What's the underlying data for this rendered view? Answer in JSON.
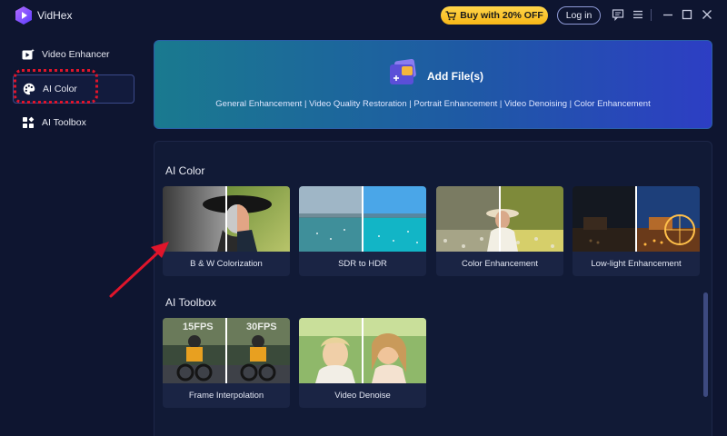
{
  "app": {
    "name": "VidHex"
  },
  "header": {
    "buy_label": "Buy with 20% OFF",
    "login_label": "Log in",
    "accent": "#f7b718"
  },
  "sidebar": {
    "items": [
      {
        "label": "Video Enhancer",
        "icon": "video-enhancer-icon"
      },
      {
        "label": "AI Color",
        "icon": "palette-icon"
      },
      {
        "label": "AI Toolbox",
        "icon": "toolbox-icon"
      }
    ],
    "active_index": 1
  },
  "banner": {
    "title": "Add File(s)",
    "subtitle": "General Enhancement | Video Quality Restoration | Portrait Enhancement | Video Denoising | Color Enhancement"
  },
  "sections": {
    "ai_color": {
      "title": "AI Color",
      "cards": [
        {
          "label": "B & W Colorization"
        },
        {
          "label": "SDR to HDR"
        },
        {
          "label": "Color Enhancement"
        },
        {
          "label": "Low-light Enhancement"
        }
      ]
    },
    "ai_toolbox": {
      "title": "AI Toolbox",
      "cards": [
        {
          "label": "Frame Interpolation",
          "badges": [
            "15FPS",
            "30FPS"
          ]
        },
        {
          "label": "Video Denoise"
        }
      ]
    }
  }
}
